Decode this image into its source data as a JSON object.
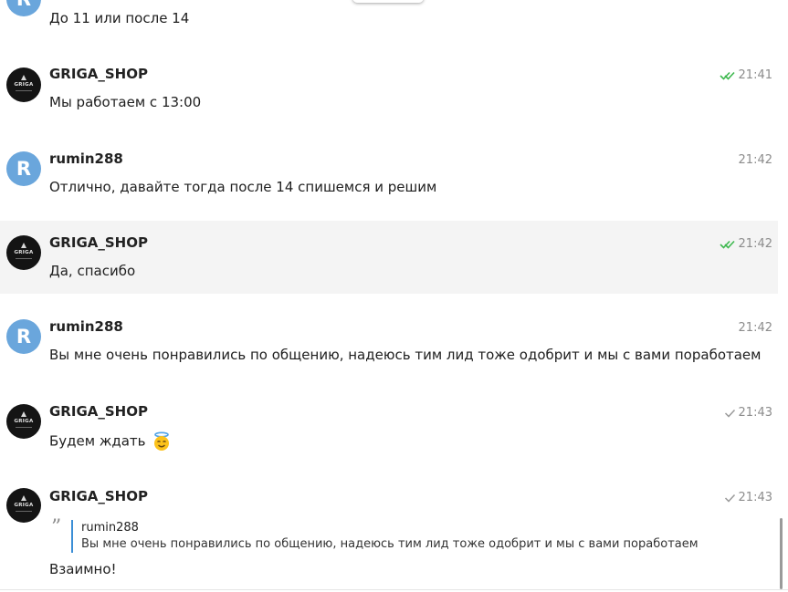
{
  "messages": [
    {
      "sender": "",
      "avatar_letter": "R",
      "time": "",
      "text": "До 11 или после 14"
    },
    {
      "sender": "GRIGA_SHOP",
      "avatar_text": "GRIGA",
      "time": "21:41",
      "status": "read",
      "text": "Мы работаем с 13:00"
    },
    {
      "sender": "rumin288",
      "avatar_letter": "R",
      "time": "21:42",
      "text": "Отлично, давайте тогда после 14 спишемся и решим"
    },
    {
      "sender": "GRIGA_SHOP",
      "avatar_text": "GRIGA",
      "time": "21:42",
      "status": "read",
      "text": "Да, спасибо"
    },
    {
      "sender": "rumin288",
      "avatar_letter": "R",
      "time": "21:42",
      "text": "Вы мне очень понравились по общению, надеюсь тим лид тоже одобрит и мы с вами поработаем"
    },
    {
      "sender": "GRIGA_SHOP",
      "avatar_text": "GRIGA",
      "time": "21:43",
      "status": "sent",
      "text": "Будем ждать",
      "emoji": "smiling-face-with-halo"
    },
    {
      "sender": "GRIGA_SHOP",
      "avatar_text": "GRIGA",
      "time": "21:43",
      "status": "sent",
      "reply_to": {
        "author": "rumin288",
        "text": "Вы мне очень понравились по общению, надеюсь тим лид тоже одобрит и мы с вами поработаем"
      },
      "text": "Взаимно!"
    }
  ],
  "colors": {
    "read_check": "#3db84e",
    "sent_check": "#9a9a9a",
    "quote_bar": "#3b8ed6",
    "highlight_bg": "#f4f4f4",
    "user_avatar": "#6aa6dc"
  }
}
